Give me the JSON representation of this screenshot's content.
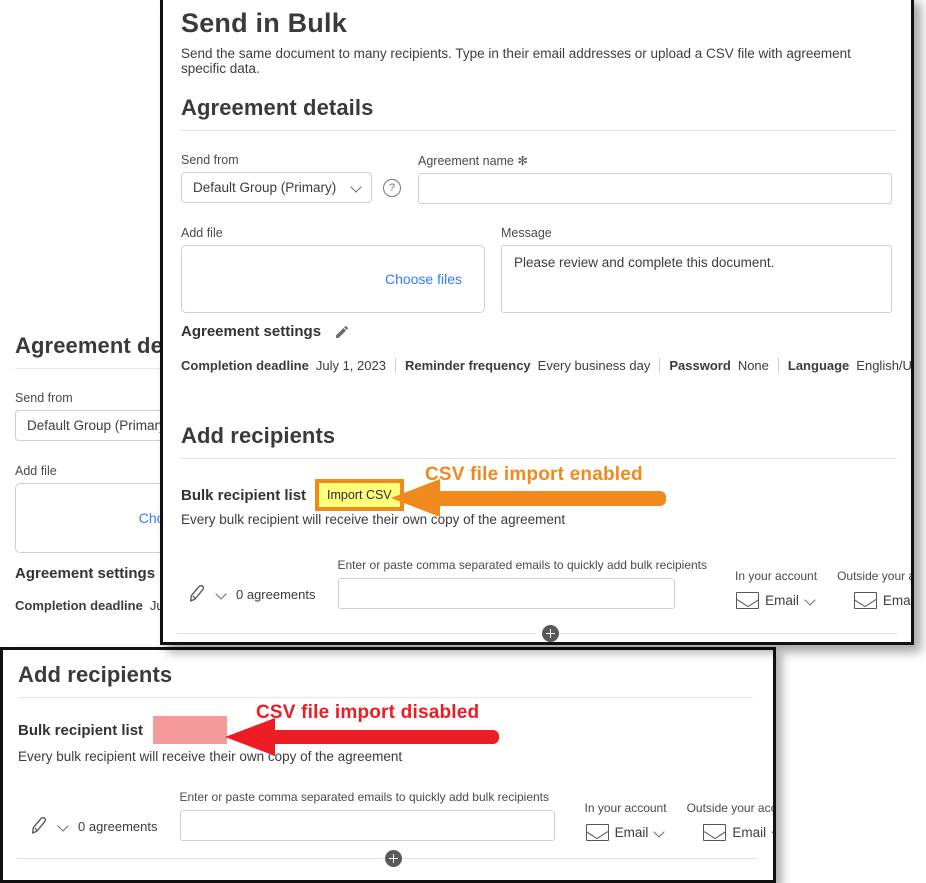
{
  "top_card": {
    "title": "Send in Bulk",
    "subtitle": "Send the same document to many recipients. Type in their email addresses or upload a CSV file with agreement specific data.",
    "agreement_details": {
      "heading": "Agreement details",
      "send_from_label": "Send from",
      "send_from_value": "Default Group (Primary)",
      "help_icon": "question-mark-icon",
      "agreement_name_label": "Agreement name",
      "agreement_name_required_marker": "✻",
      "agreement_name_value": "",
      "add_file_label": "Add file",
      "choose_files_label": "Choose files",
      "message_label": "Message",
      "message_value": "Please review and complete this document."
    },
    "agreement_settings": {
      "heading": "Agreement settings",
      "edit_icon": "pencil-icon",
      "items": [
        {
          "label": "Completion deadline",
          "value": "July 1, 2023"
        },
        {
          "label": "Reminder frequency",
          "value": "Every business day"
        },
        {
          "label": "Password",
          "value": "None"
        },
        {
          "label": "Language",
          "value": "English/US"
        }
      ]
    },
    "add_recipients": {
      "heading": "Add recipients",
      "bulk_list_label": "Bulk recipient list",
      "import_csv_label": "Import CSV",
      "note": "Every bulk recipient will receive their own copy of the agreement",
      "emails_label": "Enter or paste comma separated emails to quickly add bulk recipients",
      "emails_value": "",
      "agreements_count": "0 agreements",
      "pen_icon": "pen-nib-icon",
      "in_account_label": "In your account",
      "outside_account_label": "Outside your account",
      "in_account_value": "Email",
      "outside_account_value": "Email",
      "add_row_icon": "plus-circle-icon"
    },
    "callout": {
      "text": "CSV file import enabled",
      "color": "#f08a1e"
    }
  },
  "bottom_panel": {
    "heading": "Add recipients",
    "bulk_list_label": "Bulk recipient list",
    "import_csv_redacted": "",
    "note": "Every bulk recipient will receive their own copy of the agreement",
    "emails_label": "Enter or paste comma separated emails to quickly add bulk recipients",
    "emails_value": "",
    "agreements_count": "0 agreements",
    "pen_icon": "pen-nib-icon",
    "in_account_label": "In your account",
    "outside_account_label": "Outside your account",
    "in_account_value": "Email",
    "outside_account_value": "Email",
    "add_row_icon": "plus-circle-icon",
    "callout": {
      "text": "CSV file import disabled",
      "color": "#ee1c25",
      "redaction_color": "#f59a9a"
    }
  },
  "background_panel": {
    "heading": "Agreement deta",
    "send_from_label": "Send from",
    "send_from_value": "Default Group (Primary)",
    "add_file_label": "Add file",
    "choose_files_label": "Choose",
    "settings_heading": "Agreement settings",
    "deadline_label": "Completion deadline",
    "deadline_value": "July",
    "recipients_heading": "Add recipients"
  }
}
